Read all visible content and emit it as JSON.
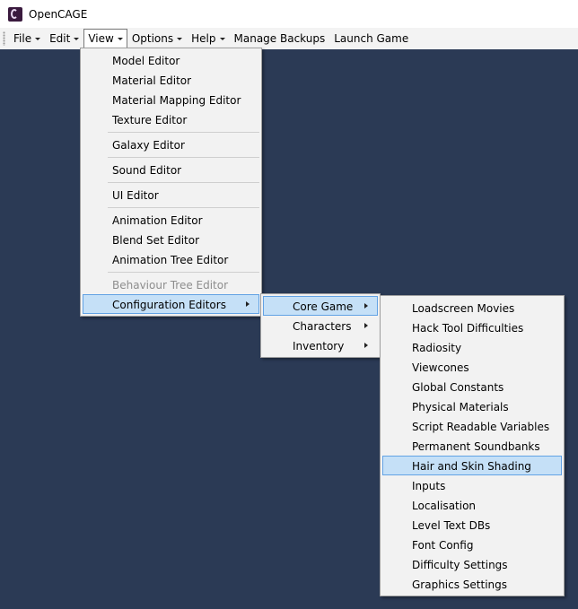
{
  "window": {
    "title": "OpenCAGE"
  },
  "menubar": {
    "items": [
      {
        "label": "File",
        "dropdown": true
      },
      {
        "label": "Edit",
        "dropdown": true
      },
      {
        "label": "View",
        "dropdown": true,
        "open": true
      },
      {
        "label": "Options",
        "dropdown": true
      },
      {
        "label": "Help",
        "dropdown": true
      },
      {
        "label": "Manage Backups",
        "dropdown": false
      },
      {
        "label": "Launch Game",
        "dropdown": false
      }
    ]
  },
  "view_menu": {
    "model_editor": "Model Editor",
    "material_editor": "Material Editor",
    "material_mapping_editor": "Material Mapping Editor",
    "texture_editor": "Texture Editor",
    "galaxy_editor": "Galaxy Editor",
    "sound_editor": "Sound Editor",
    "ui_editor": "UI Editor",
    "animation_editor": "Animation Editor",
    "blend_set_editor": "Blend Set Editor",
    "animation_tree_editor": "Animation Tree Editor",
    "behaviour_tree_editor": "Behaviour Tree Editor",
    "configuration_editors": "Configuration Editors"
  },
  "config_menu": {
    "core_game": "Core Game",
    "characters": "Characters",
    "inventory": "Inventory"
  },
  "core_game_menu": {
    "items": [
      "Loadscreen Movies",
      "Hack Tool Difficulties",
      "Radiosity",
      "Viewcones",
      "Global Constants",
      "Physical Materials",
      "Script Readable Variables",
      "Permanent Soundbanks",
      "Hair and Skin Shading",
      "Inputs",
      "Localisation",
      "Level Text DBs",
      "Font Config",
      "Difficulty Settings",
      "Graphics Settings"
    ],
    "highlighted": "Hair and Skin Shading"
  },
  "colors": {
    "background": "#2b3a55",
    "highlight": "#c5e0f7",
    "highlight_border": "#62a2e4"
  }
}
